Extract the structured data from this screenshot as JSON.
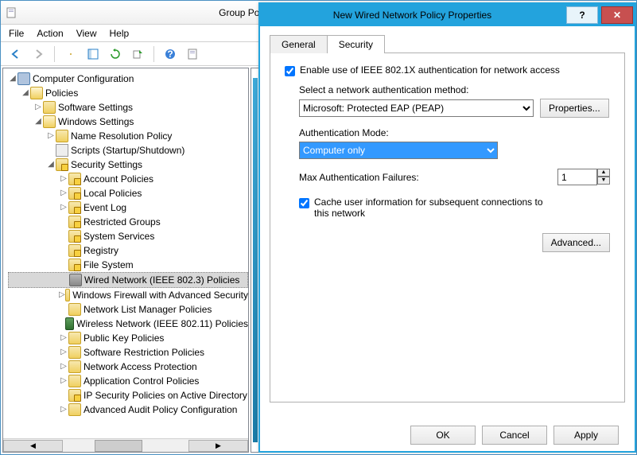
{
  "window": {
    "title": "Group Policy Management Editor",
    "menu": [
      "File",
      "Action",
      "View",
      "Help"
    ]
  },
  "tree": {
    "root": "Computer Configuration",
    "policies": "Policies",
    "software": "Software Settings",
    "windows": "Windows Settings",
    "namereso": "Name Resolution Policy",
    "scripts": "Scripts (Startup/Shutdown)",
    "security": "Security Settings",
    "account": "Account Policies",
    "local": "Local Policies",
    "event": "Event Log",
    "restricted": "Restricted Groups",
    "services": "System Services",
    "registry": "Registry",
    "filesys": "File System",
    "wired": "Wired Network (IEEE 802.3) Policies",
    "wfirewall": "Windows Firewall with Advanced Security",
    "netlist": "Network List Manager Policies",
    "wireless": "Wireless Network (IEEE 802.11) Policies",
    "pubkey": "Public Key Policies",
    "swrestrict": "Software Restriction Policies",
    "nap": "Network Access Protection",
    "appctrl": "Application Control Policies",
    "ipsec": "IP Security Policies on Active Directory",
    "audit": "Advanced Audit Policy Configuration"
  },
  "dialog": {
    "title": "New Wired Network Policy Properties",
    "tabs": {
      "general": "General",
      "security": "Security"
    },
    "enable8021x": "Enable use of IEEE 802.1X authentication for network access",
    "selectMethodLabel": "Select a network authentication method:",
    "method": "Microsoft: Protected EAP (PEAP)",
    "propertiesBtn": "Properties...",
    "authModeLabel": "Authentication Mode:",
    "authMode": "Computer only",
    "maxFailLabel": "Max Authentication Failures:",
    "maxFail": "1",
    "cacheLabel": "Cache user information for subsequent connections to this network",
    "advancedBtn": "Advanced...",
    "ok": "OK",
    "cancel": "Cancel",
    "apply": "Apply"
  }
}
